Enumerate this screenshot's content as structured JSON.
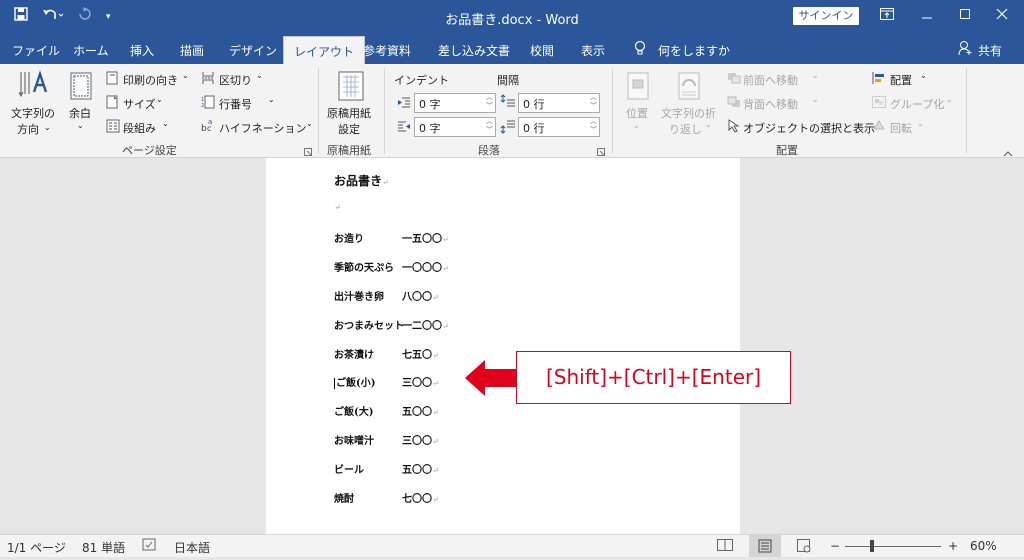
{
  "window": {
    "title": "お品書き.docx  -  Word",
    "signin_label": "サインイン",
    "share_label": "共有"
  },
  "tabs": [
    "ファイル",
    "ホーム",
    "挿入",
    "描画",
    "デザイン",
    "レイアウト",
    "参考資料",
    "差し込み文書",
    "校閲",
    "表示"
  ],
  "active_tab": "レイアウト",
  "tellme": "何をしますか",
  "ribbon": {
    "page_setup": {
      "text_direction_1": "文字列の",
      "text_direction_2": "方向",
      "margins": "余白",
      "orientation": "印刷の向き",
      "size": "サイズ",
      "columns": "段組み",
      "breaks": "区切り",
      "line_numbers": "行番号",
      "hyphenation": "ハイフネーション",
      "group_label": "ページ設定"
    },
    "genko": {
      "label_1": "原稿用紙",
      "label_2": "設定",
      "group_label": "原稿用紙"
    },
    "paragraph": {
      "indent_title": "インデント",
      "spacing_title": "間隔",
      "indent_left": "0 字",
      "indent_right": "0 字",
      "spacing_before": "0 行",
      "spacing_after": "0 行",
      "group_label": "段落"
    },
    "arrange": {
      "position": "位置",
      "wrap_1": "文字列の折",
      "wrap_2": "り返し",
      "bring_forward": "前面へ移動",
      "send_backward": "背面へ移動",
      "selection_pane": "オブジェクトの選択と表示",
      "align": "配置",
      "group": "グループ化",
      "rotate": "回転",
      "group_label": "配置"
    }
  },
  "document": {
    "title": "お品書き",
    "items": [
      {
        "name": "お造り",
        "price": "一五〇〇"
      },
      {
        "name": "季節の天ぷら",
        "price": "一〇〇〇"
      },
      {
        "name": "出汁巻き卵",
        "price": "八〇〇"
      },
      {
        "name": "おつまみセット",
        "price": "一二〇〇"
      },
      {
        "name": "お茶漬け",
        "price": "七五〇"
      },
      {
        "name": "ご飯(小)",
        "price": "三〇〇"
      },
      {
        "name": "ご飯(大)",
        "price": "五〇〇"
      },
      {
        "name": "お味噌汁",
        "price": "三〇〇"
      },
      {
        "name": "ビール",
        "price": "五〇〇"
      },
      {
        "name": "焼酎",
        "price": "七〇〇"
      }
    ],
    "para_mark": "↵"
  },
  "annotation": {
    "shortcut": "[Shift]+[Ctrl]+[Enter]",
    "color": "#e0001b"
  },
  "status": {
    "page": "1/1 ページ",
    "words": "81 単語",
    "language": "日本語",
    "zoom": "60%"
  }
}
